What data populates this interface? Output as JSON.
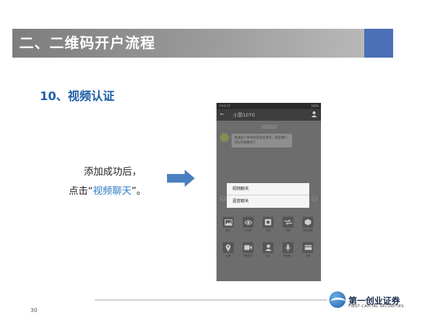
{
  "slide": {
    "title": "二、二维码开户流程",
    "section_heading": "10、视频认证",
    "instruction_line1": "添加成功后，",
    "instruction_line2_prefix": "点击“",
    "instruction_line2_highlight": "视频聊天",
    "instruction_line2_suffix": "”。",
    "page_number": "30",
    "colors": {
      "title_bar": "#8c8c8c",
      "accent": "#4a6fb5",
      "heading": "#1f5fa8",
      "highlight": "#2b7bc6",
      "arrow": "#4a7fc1"
    }
  },
  "phone": {
    "status_time": "下午4:17",
    "status_right": "100%",
    "nav_title": "小郭1070",
    "chat_message": "我通过了你的好友验证请求，现在我们可以开始聊天了",
    "dialog_items": [
      "视频聊天",
      "语音聊天"
    ],
    "grid_items": [
      {
        "icon": "image-icon",
        "label": "图片"
      },
      {
        "icon": "eye-icon",
        "label": "小视频"
      },
      {
        "icon": "camera-icon",
        "label": "拍照"
      },
      {
        "icon": "transfer-icon",
        "label": "转账"
      },
      {
        "icon": "cube-icon",
        "label": "我的收藏"
      },
      {
        "icon": "location-icon",
        "label": "位置"
      },
      {
        "icon": "video-icon",
        "label": "视频聊天"
      },
      {
        "icon": "contact-icon",
        "label": "名片"
      },
      {
        "icon": "voice-icon",
        "label": "语音输入"
      },
      {
        "icon": "card-icon",
        "label": "卡券"
      }
    ]
  },
  "logo": {
    "name": "第一创业证券",
    "subtitle": "FIRST CAPITAL SECURITIES"
  }
}
